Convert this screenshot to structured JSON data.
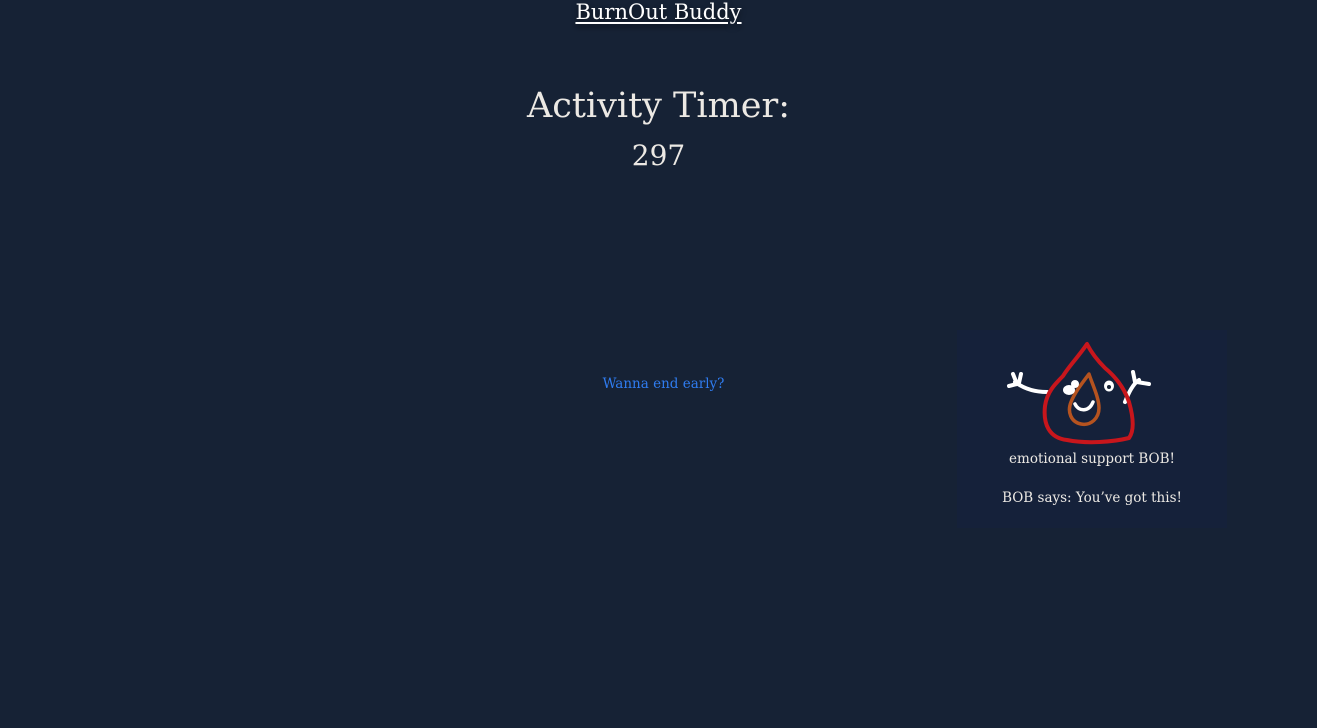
{
  "header": {
    "brand_label": "BurnOut Buddy"
  },
  "timer": {
    "title": "Activity Timer:",
    "value": "297"
  },
  "actions": {
    "end_early_label": "Wanna end early?"
  },
  "bob": {
    "caption": "emotional support BOB!",
    "says": "BOB says: You’ve got this!"
  },
  "colors": {
    "background": "#162235",
    "card_background": "#15213a",
    "link": "#2f7cf0",
    "flame_outer": "#c8161c",
    "flame_inner": "#b5531f"
  }
}
